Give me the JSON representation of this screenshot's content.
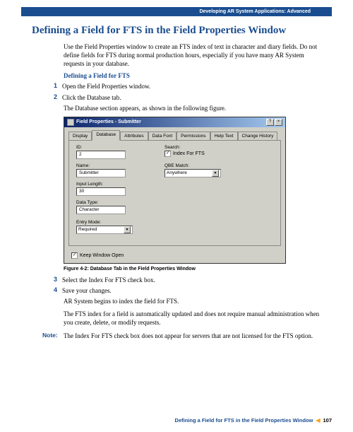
{
  "header": {
    "breadcrumb": "Developing AR System Applications: Advanced"
  },
  "title": "Defining a Field for FTS in the Field Properties Window",
  "intro": "Use the Field Properties window to create an FTS index of text in character and diary fields. Do not define fields for FTS during normal production hours, especially if you have many AR System requests in your database.",
  "subheading": "Defining a Field for FTS",
  "steps": {
    "s1_num": "1",
    "s1_text": "Open the Field Properties window.",
    "s2_num": "2",
    "s2_text": "Click the Database tab.",
    "s2_after": "The Database section appears, as shown in the following figure.",
    "s3_num": "3",
    "s3_text": "Select the Index For FTS check box.",
    "s4_num": "4",
    "s4_text": "Save your changes.",
    "s4_after1": "AR System begins to index the field for FTS.",
    "s4_after2": "The FTS index for a field is automatically updated and does not require manual administration when you create, delete, or modify requests."
  },
  "dialog": {
    "title": "Field Properties - Submitter",
    "tabs": {
      "display": "Display",
      "database": "Database",
      "attributes": "Attributes",
      "dataFont": "Data Font",
      "permissions": "Permissions",
      "helpText": "Help Text",
      "changeHistory": "Change History"
    },
    "fields": {
      "id_label": "ID:",
      "id_value": "2",
      "name_label": "Name:",
      "name_value": "Submitter",
      "inputLength_label": "Input Length:",
      "inputLength_value": "30",
      "dataType_label": "Data Type:",
      "dataType_value": "Character",
      "entryMode_label": "Entry Mode:",
      "entryMode_value": "Required",
      "search_label": "Search:",
      "indexForFts_label": "Index For FTS",
      "qbeMatch_label": "QBE Match:",
      "qbeMatch_value": "Anywhere",
      "keepWindowOpen_label": "Keep Window Open"
    }
  },
  "figure_caption": "Figure 4-2:  Database Tab in the Field Properties Window",
  "note": {
    "label": "Note:",
    "text": "The Index For FTS check box does not appear for servers that are not licensed for the FTS option."
  },
  "footer": {
    "title": "Defining a Field for FTS in the Field Properties Window",
    "marker": "◀",
    "page": "107"
  }
}
